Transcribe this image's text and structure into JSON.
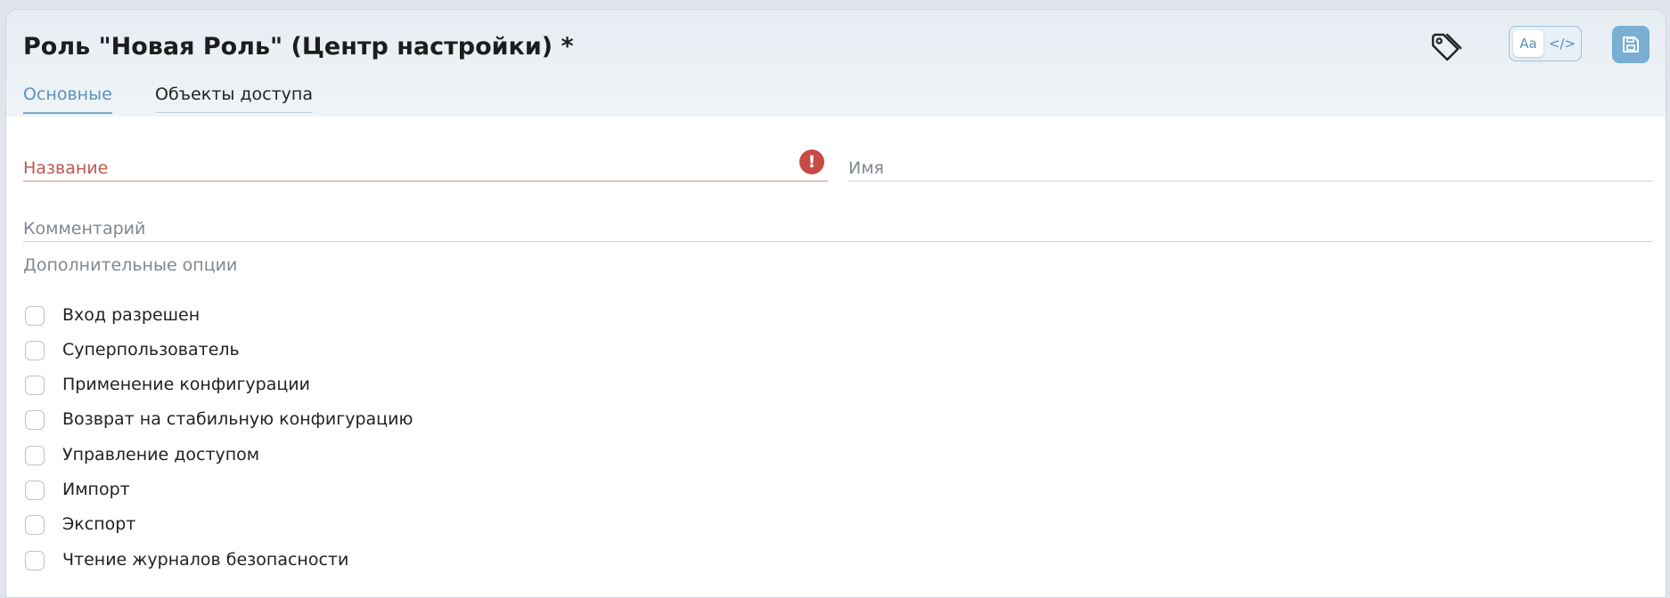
{
  "header": {
    "title": "Роль \"Новая Роль\" (Центр настройки) *",
    "tabs": [
      {
        "label": "Основные",
        "active": true
      },
      {
        "label": "Объекты доступа",
        "active": false
      }
    ],
    "toolbar": {
      "tag_icon": "tag-icon",
      "view_toggle": {
        "text_label": "Aa",
        "code_label": "</>",
        "selected": "Aa"
      },
      "save_icon": "save-icon"
    }
  },
  "form": {
    "name_field": {
      "placeholder": "Название",
      "value": "",
      "error": true,
      "error_icon": "!"
    },
    "imya_field": {
      "placeholder": "Имя",
      "value": ""
    },
    "comment_field": {
      "placeholder": "Комментарий",
      "value": ""
    },
    "options_label": "Дополнительные опции",
    "options": [
      {
        "label": "Вход разрешен",
        "checked": false
      },
      {
        "label": "Суперпользователь",
        "checked": false
      },
      {
        "label": "Применение конфигурации",
        "checked": false
      },
      {
        "label": "Возврат на стабильную конфигурацию",
        "checked": false
      },
      {
        "label": "Управление доступом",
        "checked": false
      },
      {
        "label": "Импорт",
        "checked": false
      },
      {
        "label": "Экспорт",
        "checked": false
      },
      {
        "label": "Чтение журналов безопасности",
        "checked": false
      }
    ]
  },
  "colors": {
    "accent": "#7aaed3",
    "error": "#c64b44",
    "tab_active": "#5a93bd"
  }
}
